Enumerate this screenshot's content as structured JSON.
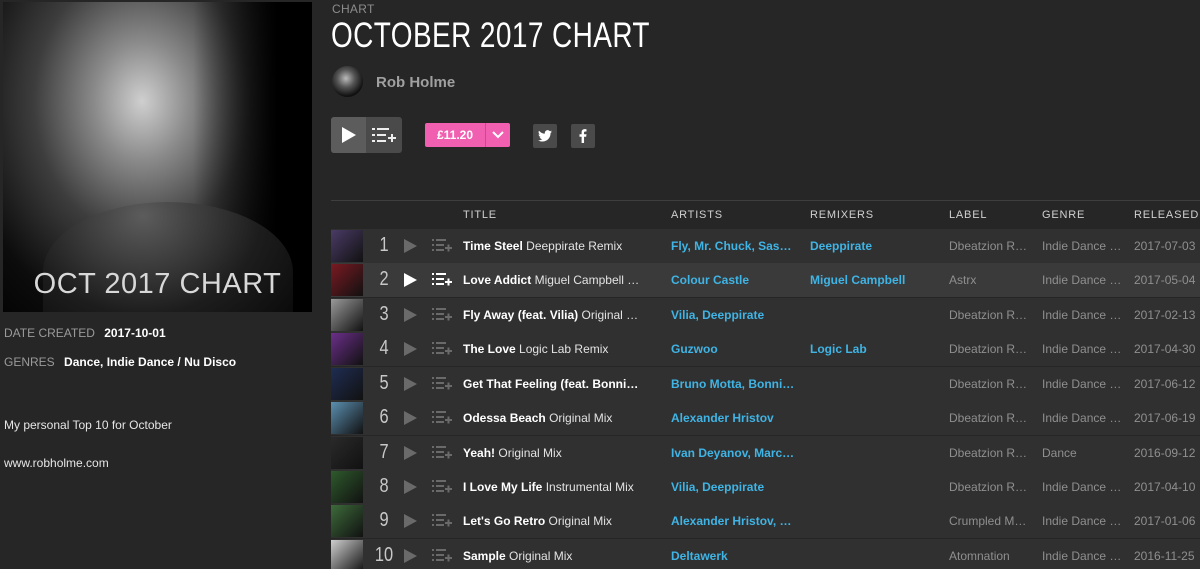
{
  "cover": {
    "caption": "OCT  2017 CHART"
  },
  "meta": {
    "date_label": "DATE CREATED",
    "date_value": "2017-10-01",
    "genres_label": "GENRES",
    "genres_value": "Dance, Indie Dance / Nu Disco"
  },
  "description": {
    "line1": "My personal Top 10 for October",
    "line2": "www.robholme.com"
  },
  "header": {
    "crumb": "CHART",
    "title": "OCTOBER 2017 CHART",
    "artist": "Rob Holme"
  },
  "actions": {
    "play_icon": "play-icon",
    "queue_icon": "add-to-queue-icon",
    "price": "£11.20",
    "twitter_icon": "twitter-icon",
    "facebook_icon": "facebook-icon",
    "accent_color": "#f15fb0",
    "link_color": "#3fb4e5"
  },
  "columns": {
    "title": "TITLE",
    "artists": "ARTISTS",
    "remixers": "REMIXERS",
    "label": "LABEL",
    "genre": "GENRE",
    "released": "RELEASED"
  },
  "tracks": [
    {
      "num": "1",
      "name": "Time Steel",
      "mix": "Deeppirate Remix",
      "artists": "Fly, Mr. Chuck, Sas…",
      "remixers": "Deeppirate",
      "label": "Dbeatzion R…",
      "genre": "Indie Dance …",
      "released": "2017-07-03",
      "art_color": "#4a3b66"
    },
    {
      "num": "2",
      "name": "Love Addict",
      "mix": "Miguel Campbell …",
      "artists": "Colour Castle",
      "remixers": "Miguel Campbell",
      "label": "Astrx",
      "genre": "Indie Dance …",
      "released": "2017-05-04",
      "art_color": "#7a1a22"
    },
    {
      "num": "3",
      "name": "Fly Away (feat. Vilia)",
      "mix": "Original …",
      "artists": "Vilia, Deeppirate",
      "remixers": "",
      "label": "Dbeatzion R…",
      "genre": "Indie Dance …",
      "released": "2017-02-13",
      "art_color": "#9a9a9a"
    },
    {
      "num": "4",
      "name": "The Love",
      "mix": "Logic Lab Remix",
      "artists": "Guzwoo",
      "remixers": "Logic Lab",
      "label": "Dbeatzion R…",
      "genre": "Indie Dance …",
      "released": "2017-04-30",
      "art_color": "#6b2f8a"
    },
    {
      "num": "5",
      "name": "Get That Feeling (feat. Bonni…",
      "mix": "",
      "artists": "Bruno Motta, Bonni…",
      "remixers": "",
      "label": "Dbeatzion R…",
      "genre": "Indie Dance …",
      "released": "2017-06-12",
      "art_color": "#1f2d52"
    },
    {
      "num": "6",
      "name": "Odessa Beach",
      "mix": "Original Mix",
      "artists": "Alexander Hristov",
      "remixers": "",
      "label": "Dbeatzion R…",
      "genre": "Indie Dance …",
      "released": "2017-06-19",
      "art_color": "#5b8fb0"
    },
    {
      "num": "7",
      "name": "Yeah!",
      "mix": "Original Mix",
      "artists": "Ivan Deyanov, Marc…",
      "remixers": "",
      "label": "Dbeatzion R…",
      "genre": "Dance",
      "released": "2016-09-12",
      "art_color": "#2a2a2a"
    },
    {
      "num": "8",
      "name": "I Love My Life",
      "mix": "Instrumental Mix",
      "artists": "Vilia, Deeppirate",
      "remixers": "",
      "label": "Dbeatzion R…",
      "genre": "Indie Dance …",
      "released": "2017-04-10",
      "art_color": "#2e5a2c"
    },
    {
      "num": "9",
      "name": "Let's Go Retro",
      "mix": "Original Mix",
      "artists": "Alexander Hristov, …",
      "remixers": "",
      "label": "Crumpled M…",
      "genre": "Indie Dance …",
      "released": "2017-01-06",
      "art_color": "#3d6b3a"
    },
    {
      "num": "10",
      "name": "Sample",
      "mix": "Original Mix",
      "artists": "Deltawerk",
      "remixers": "",
      "label": "Atomnation",
      "genre": "Indie Dance …",
      "released": "2016-11-25",
      "art_color": "#cfcfcf"
    }
  ]
}
